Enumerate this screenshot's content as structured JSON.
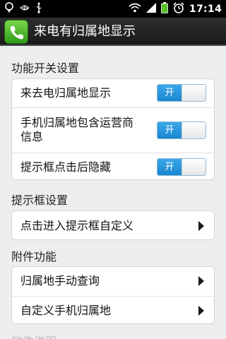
{
  "status_bar": {
    "battery_left_percent": "100%",
    "time": "17:14"
  },
  "app": {
    "title": "来电有归属地显示"
  },
  "sections": {
    "switches": {
      "header": "功能开关设置",
      "items": [
        {
          "label": "来去电归属地显示",
          "toggle_label": "开"
        },
        {
          "label_line1": "手机归属地包含运营商",
          "label_line2": "信息",
          "toggle_label": "开"
        },
        {
          "label": "提示框点击后隐藏",
          "toggle_label": "开"
        }
      ]
    },
    "popup": {
      "header": "提示框设置",
      "items": [
        {
          "label": "点击进入提示框自定义"
        }
      ]
    },
    "extras": {
      "header": "附件功能",
      "items": [
        {
          "label": "归属地手动查询"
        },
        {
          "label": "自定义手机归属地"
        }
      ]
    },
    "next": {
      "header": "软件说明"
    }
  }
}
